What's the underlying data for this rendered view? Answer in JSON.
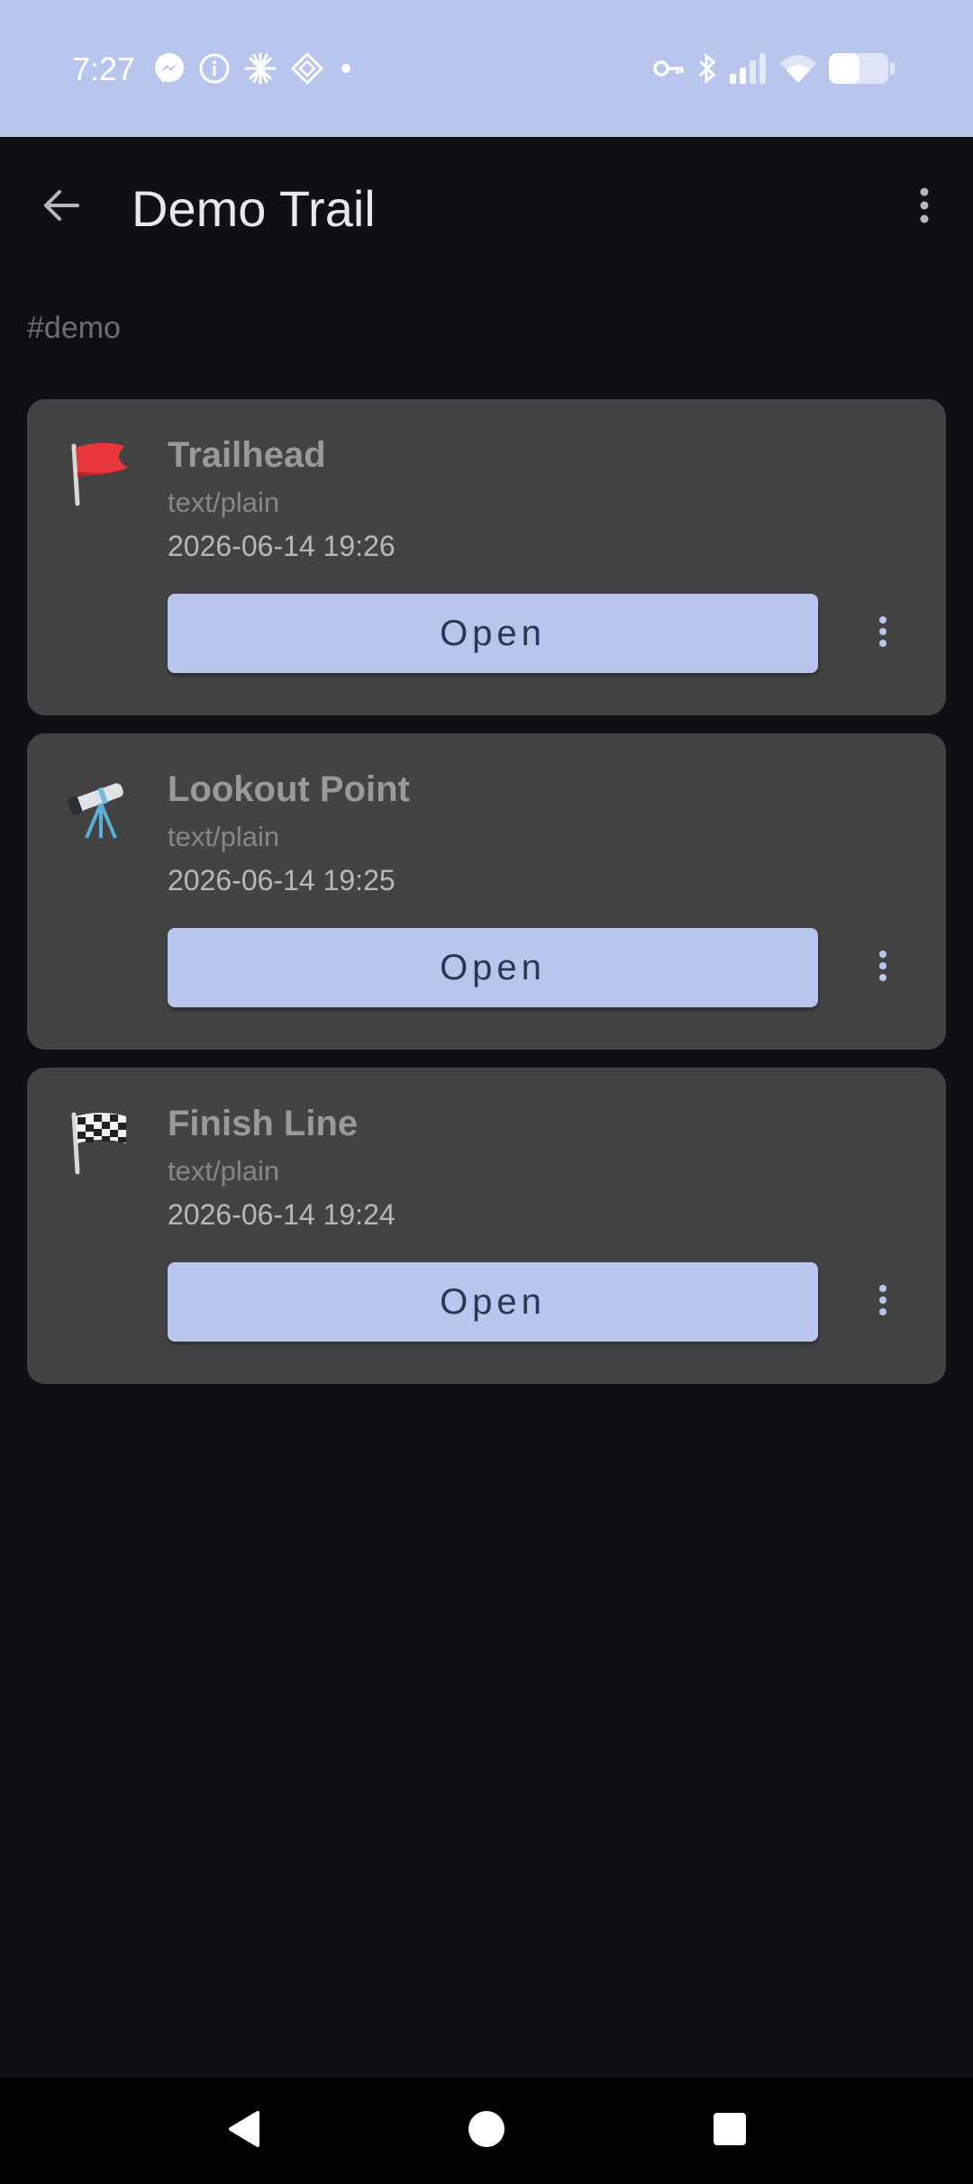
{
  "status_bar": {
    "time": "7:27",
    "left_icons": [
      "messenger-icon",
      "info-icon",
      "sparkle-icon",
      "diamond-icon",
      "dot-icon"
    ],
    "right_icons": [
      "key-icon",
      "bluetooth-icon",
      "signal-icon",
      "wifi-icon",
      "battery-icon"
    ],
    "background": "#b8c6ee"
  },
  "app_bar": {
    "title": "Demo Trail",
    "back_icon": "arrow-back-icon",
    "menu_icon": "more-vert-icon"
  },
  "tag": "#demo",
  "cards": [
    {
      "emoji": "flag-icon",
      "name": "Trailhead",
      "mime": "text/plain",
      "date": "2026-06-14 19:26",
      "open_label": "Open"
    },
    {
      "emoji": "telescope-icon",
      "name": "Lookout Point",
      "mime": "text/plain",
      "date": "2026-06-14 19:25",
      "open_label": "Open"
    },
    {
      "emoji": "checkered-flag-icon",
      "name": "Finish Line",
      "mime": "text/plain",
      "date": "2026-06-14 19:24",
      "open_label": "Open"
    }
  ],
  "colors": {
    "background": "#0f1014",
    "card": "#434343",
    "accent": "#b8c6ee",
    "button_text": "#2e3553"
  },
  "nav_bar": [
    "back-triangle-icon",
    "home-circle-icon",
    "recents-square-icon"
  ]
}
